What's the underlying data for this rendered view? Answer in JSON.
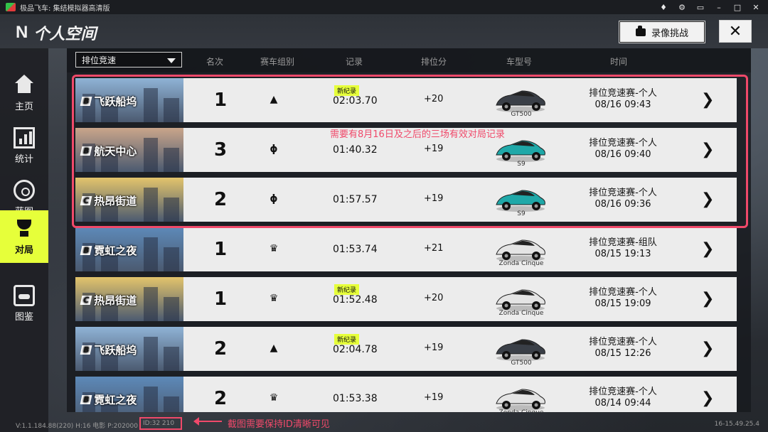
{
  "window": {
    "title": "极品飞车: 集结模拟器高清版"
  },
  "header": {
    "page_title": "个人空间",
    "challenge_button": "录像挑战"
  },
  "sidebar": {
    "items": [
      {
        "label": "主页",
        "icon": "garage-home-icon"
      },
      {
        "label": "统计",
        "icon": "stats-icon"
      },
      {
        "label": "蓝图",
        "icon": "blueprint-icon"
      },
      {
        "label": "对局",
        "icon": "trophy-icon",
        "active": true
      },
      {
        "label": "图鉴",
        "icon": "car-atlas-icon"
      }
    ]
  },
  "table": {
    "mode_select": "排位竞速",
    "columns": [
      "名次",
      "赛车组别",
      "记录",
      "排位分",
      "车型号",
      "时间"
    ]
  },
  "rows": [
    {
      "track": "飞跃船坞",
      "grade": "B",
      "rank": "1",
      "group_icon": "mountain-icon",
      "new_record": "新纪录",
      "time": "02:03.70",
      "points": "+20",
      "car": "GT500",
      "race_type": "排位竞速赛-个人",
      "date": "08/16  09:43",
      "thumb_color": "#8fb3d6"
    },
    {
      "track": "航天中心",
      "grade": "B",
      "rank": "3",
      "group_icon": "swirl-icon",
      "new_record": "",
      "time": "01:40.32",
      "points": "+19",
      "car": "S9",
      "race_type": "排位竞速赛-个人",
      "date": "08/16  09:40",
      "thumb_color": "#c9a58a"
    },
    {
      "track": "热昂街道",
      "grade": "C",
      "rank": "2",
      "group_icon": "swirl-icon",
      "new_record": "",
      "time": "01:57.57",
      "points": "+19",
      "car": "S9",
      "race_type": "排位竞速赛-个人",
      "date": "08/16  09:36",
      "thumb_color": "#e3c46b"
    },
    {
      "track": "霓虹之夜",
      "grade": "B",
      "rank": "1",
      "group_icon": "wing-badge-icon",
      "new_record": "",
      "time": "01:53.74",
      "points": "+21",
      "car": "Zonda Cinque",
      "race_type": "排位竞速赛-组队",
      "date": "08/15  19:13",
      "thumb_color": "#5d89b8"
    },
    {
      "track": "热昂街道",
      "grade": "C",
      "rank": "1",
      "group_icon": "wing-badge-icon",
      "new_record": "新纪录",
      "time": "01:52.48",
      "points": "+20",
      "car": "Zonda Cinque",
      "race_type": "排位竞速赛-个人",
      "date": "08/15  19:09",
      "thumb_color": "#e3c46b"
    },
    {
      "track": "飞跃船坞",
      "grade": "B",
      "rank": "2",
      "group_icon": "mountain-icon",
      "new_record": "新纪录",
      "time": "02:04.78",
      "points": "+19",
      "car": "GT500",
      "race_type": "排位竞速赛-个人",
      "date": "08/15  12:26",
      "thumb_color": "#8fb3d6"
    },
    {
      "track": "霓虹之夜",
      "grade": "B",
      "rank": "2",
      "group_icon": "wing-badge-icon",
      "new_record": "",
      "time": "01:53.38",
      "points": "+19",
      "car": "Zonda Cinque",
      "race_type": "排位竞速赛-个人",
      "date": "08/14  09:44",
      "thumb_color": "#5d89b8"
    }
  ],
  "annotations": {
    "highlight_note": "需要有8月16日及之后的三场有效对局记录",
    "id_note": "截图需要保持ID清晰可见"
  },
  "footer": {
    "version": "V:1.1.184.88(220) H:16 电影 P:202000",
    "id": "ID:32   210",
    "build": "16-15.49.25.4"
  },
  "colors": {
    "accent": "#e6ff3a",
    "annotation": "#f0496a",
    "row_bg": "#ececec"
  }
}
